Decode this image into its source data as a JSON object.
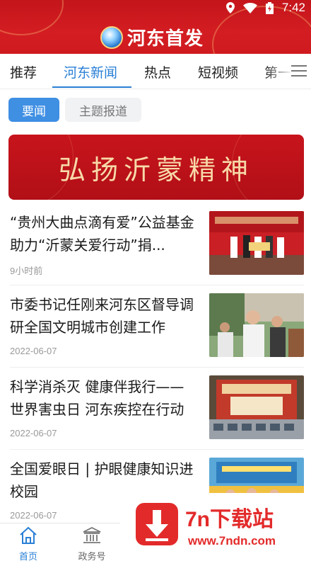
{
  "status_bar": {
    "time": "7:42"
  },
  "app": {
    "name": "河东首发"
  },
  "tabs": [
    {
      "label": "推荐",
      "active": false
    },
    {
      "label": "河东新闻",
      "active": true
    },
    {
      "label": "热点",
      "active": false
    },
    {
      "label": "短视频",
      "active": false
    },
    {
      "label": "第一",
      "active": false
    }
  ],
  "subtabs": {
    "primary": "要闻",
    "secondary": "主题报道"
  },
  "banner": {
    "text": "弘扬沂蒙精神"
  },
  "news": [
    {
      "title": "“贵州大曲点滴有爱”公益基金助力“沂蒙关爱行动”捐...",
      "date": "9小时前"
    },
    {
      "title": "市委书记任刚来河东区督导调研全国文明城市创建工作",
      "date": "2022-06-07"
    },
    {
      "title": "科学消杀灭 健康伴我行——世界害虫日 河东疾控在行动",
      "date": "2022-06-07"
    },
    {
      "title": "全国爱眼日 | 护眼健康知识进校园",
      "date": "2022-06-07"
    }
  ],
  "bottom_nav": [
    {
      "label": "首页",
      "icon": "home-icon",
      "active": true
    },
    {
      "label": "政务号",
      "icon": "government-building-icon",
      "active": false
    }
  ],
  "watermark": {
    "title": "7n下载站",
    "url": "www.7ndn.com"
  },
  "colors": {
    "header_red": "#d31d22",
    "accent_blue": "#2a7fd6",
    "watermark_red": "#e32a2a"
  }
}
